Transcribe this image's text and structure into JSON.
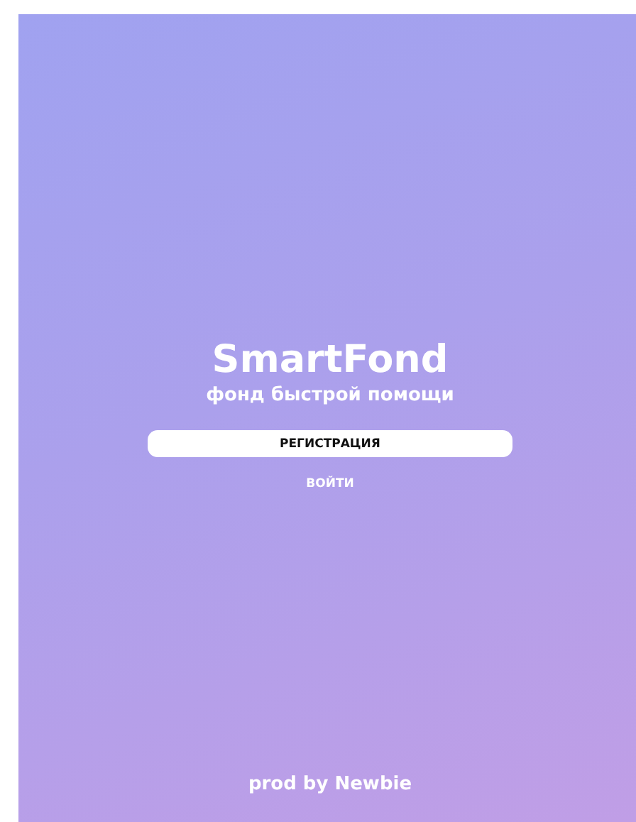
{
  "app": {
    "title": "SmartFond",
    "subtitle": "фонд быстрой помощи"
  },
  "buttons": [
    {
      "label": "РЕГИСТРАЦИЯ",
      "kind": "primary"
    },
    {
      "label": "ВОЙТИ",
      "kind": "link"
    }
  ],
  "footer": "prod by Newbie"
}
